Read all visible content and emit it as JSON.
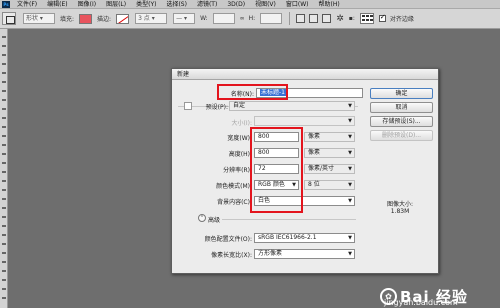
{
  "menubar": {
    "logo": "Ps",
    "items": [
      "文件(F)",
      "编辑(E)",
      "图像(I)",
      "图层(L)",
      "类型(Y)",
      "选择(S)",
      "滤镜(T)",
      "3D(D)",
      "视图(V)",
      "窗口(W)",
      "帮助(H)"
    ]
  },
  "options": {
    "mode": "形状",
    "fill_label": "填充:",
    "stroke_label": "描边:",
    "stroke_width": "3 点",
    "w_label": "W:",
    "h_label": "H:",
    "align_label": "对齐边缘",
    "fill_color": "#e8545e"
  },
  "dialog": {
    "title": "新建",
    "name_label": "名称(N):",
    "name_value": "未标题-1",
    "preset_label": "预设(P):",
    "preset_value": "自定",
    "size_label": "大小(I):",
    "width_label": "宽度(W):",
    "width_value": "800",
    "width_unit": "像素",
    "height_label": "高度(H):",
    "height_value": "800",
    "height_unit": "像素",
    "resolution_label": "分辨率(R):",
    "resolution_value": "72",
    "resolution_unit": "像素/英寸",
    "color_mode_label": "颜色模式(M):",
    "color_mode_value": "RGB 颜色",
    "bit_depth": "8 位",
    "background_label": "背景内容(C):",
    "background_value": "白色",
    "advanced_label": "高级",
    "color_profile_label": "颜色配置文件(O):",
    "color_profile_value": "sRGB IEC61966-2.1",
    "pixel_aspect_label": "像素长宽比(X):",
    "pixel_aspect_value": "方形像素",
    "ok_button": "确定",
    "cancel_button": "取消",
    "save_preset_button": "存储预设(S)...",
    "delete_preset_button": "删除预设(D)...",
    "image_size_label": "图像大小:",
    "image_size_value": "1.83M"
  },
  "watermark": {
    "text": "Bai 经验",
    "url": "jingyan.baidu.com"
  }
}
